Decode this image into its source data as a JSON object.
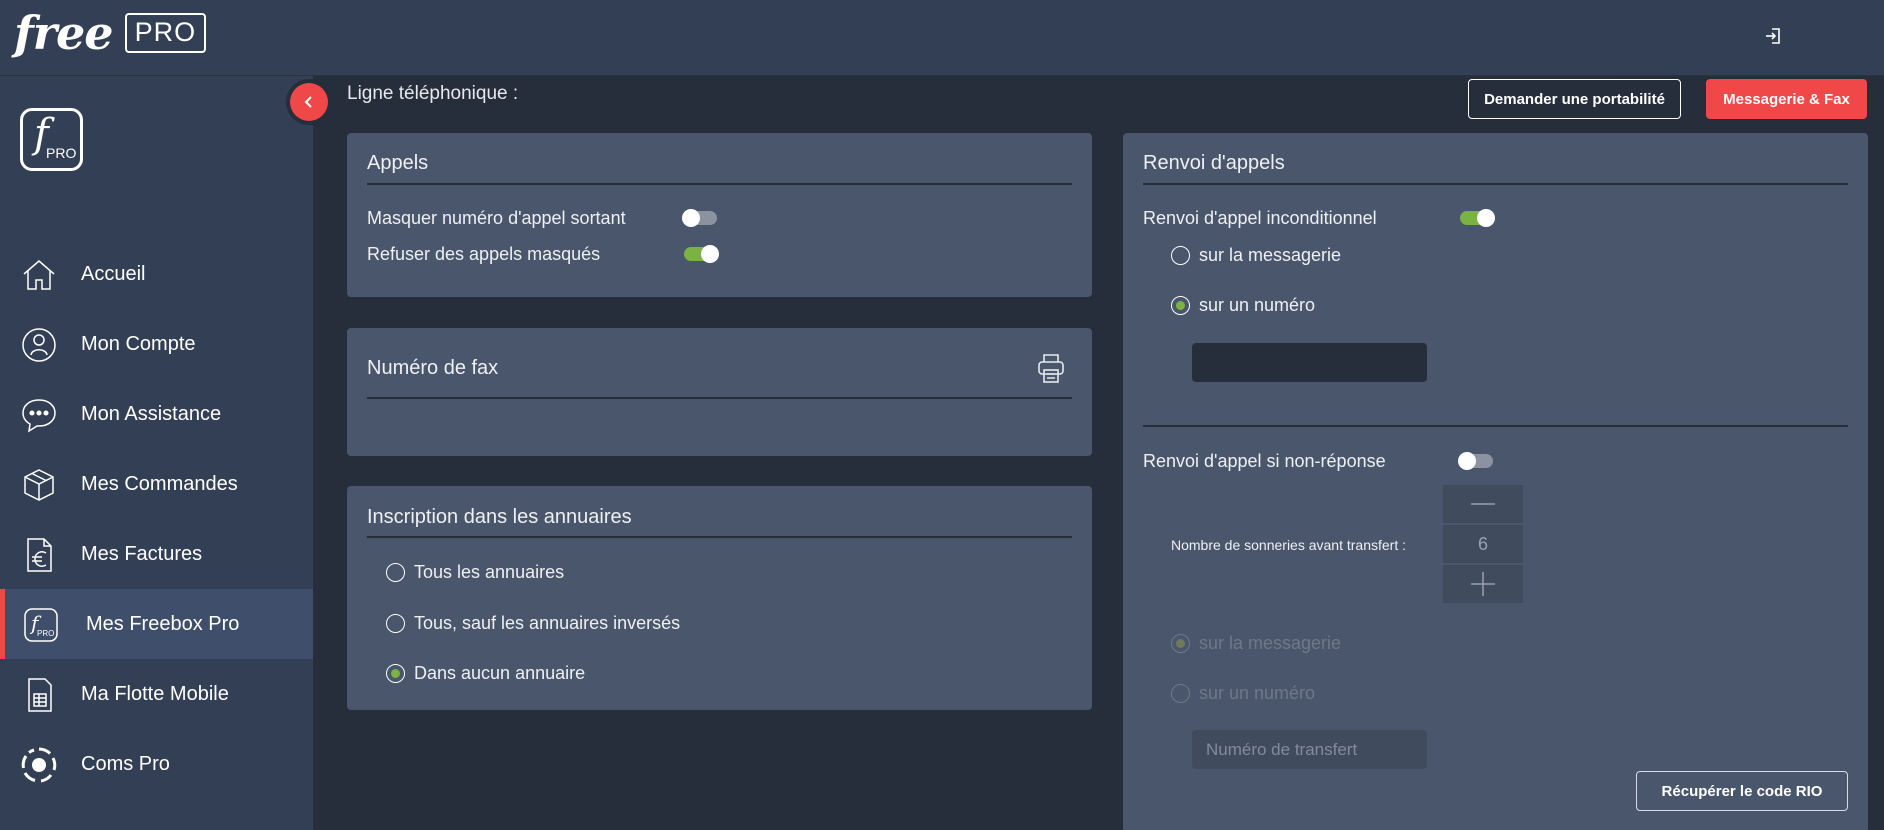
{
  "header": {
    "logo_text": "free",
    "logo_badge": "PRO",
    "logout_icon": "logout-icon"
  },
  "sidebar": {
    "logo_letter": "f",
    "logo_sub": "PRO",
    "items": [
      {
        "label": "Accueil",
        "icon": "home-icon"
      },
      {
        "label": "Mon Compte",
        "icon": "user-icon"
      },
      {
        "label": "Mon Assistance",
        "icon": "chat-icon"
      },
      {
        "label": "Mes Commandes",
        "icon": "box-icon"
      },
      {
        "label": "Mes Factures",
        "icon": "invoice-euro-icon"
      },
      {
        "label": "Mes Freebox Pro",
        "icon": "freebox-pro-icon",
        "active": true
      },
      {
        "label": "Ma Flotte Mobile",
        "icon": "sim-card-icon"
      },
      {
        "label": "Coms Pro",
        "icon": "coms-pro-icon"
      }
    ]
  },
  "page": {
    "title": "Ligne téléphonique :",
    "btn_portability": "Demander une portabilité",
    "btn_voicemail_fax": "Messagerie & Fax",
    "btn_rio": "Récupérer le code RIO"
  },
  "appels": {
    "title": "Appels",
    "hide_outgoing_label": "Masquer numéro d'appel sortant",
    "hide_outgoing_on": false,
    "refuse_masked_label": "Refuser des appels masqués",
    "refuse_masked_on": true
  },
  "fax": {
    "title": "Numéro de fax",
    "icon": "printer-icon"
  },
  "annuaires": {
    "title": "Inscription dans les annuaires",
    "options": [
      "Tous les annuaires",
      "Tous, sauf les annuaires inversés",
      "Dans aucun annuaire"
    ],
    "selected_index": 2
  },
  "renvoi": {
    "title": "Renvoi d'appels",
    "unconditional_label": "Renvoi d'appel inconditionnel",
    "unconditional_on": true,
    "unconditional_options": [
      "sur la messagerie",
      "sur un numéro"
    ],
    "unconditional_selected": 1,
    "unconditional_number": "",
    "noanswer_label": "Renvoi d'appel si non-réponse",
    "noanswer_on": false,
    "rings_label": "Nombre de sonneries avant transfert :",
    "rings_value": "6",
    "noanswer_options": [
      "sur la messagerie",
      "sur un numéro"
    ],
    "noanswer_selected": 0,
    "transfer_placeholder": "Numéro de transfert"
  },
  "colors": {
    "accent_red": "#f04848",
    "toggle_on": "#7ab342",
    "panel": "#4a566c",
    "sidebar": "#333f55",
    "background": "#262d3b"
  }
}
